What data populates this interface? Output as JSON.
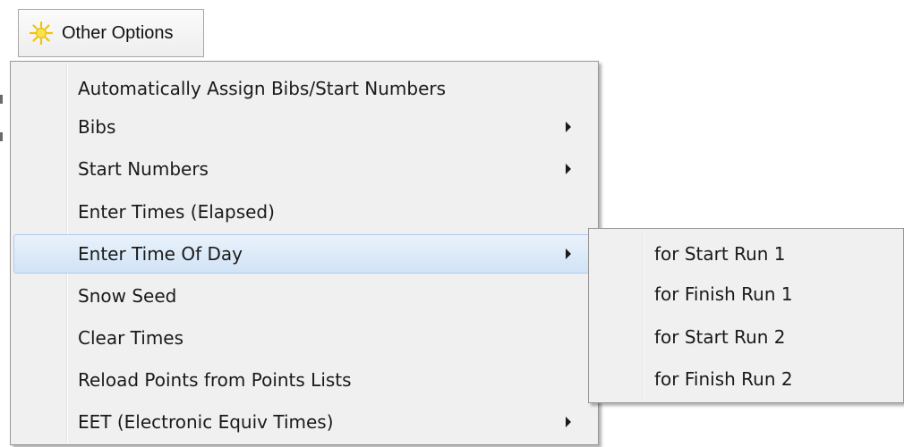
{
  "toolbar": {
    "label": "Other Options",
    "icon": "sun-icon"
  },
  "menu": {
    "items": [
      {
        "label": "Automatically Assign Bibs/Start Numbers",
        "submenu": false
      },
      {
        "label": "Bibs",
        "submenu": true
      },
      {
        "label": "Start Numbers",
        "submenu": true
      },
      {
        "label": "Enter Times (Elapsed)",
        "submenu": false
      },
      {
        "label": "Enter Time Of Day",
        "submenu": true,
        "highlighted": true
      },
      {
        "label": "Snow Seed",
        "submenu": false
      },
      {
        "label": "Clear Times",
        "submenu": false
      },
      {
        "label": "Reload Points from Points Lists",
        "submenu": false
      },
      {
        "label": "EET (Electronic Equiv Times)",
        "submenu": true
      }
    ]
  },
  "submenu": {
    "items": [
      {
        "label": "for Start Run 1"
      },
      {
        "label": "for Finish Run 1"
      },
      {
        "label": "for Start Run 2"
      },
      {
        "label": "for Finish Run 2"
      }
    ]
  },
  "colors": {
    "menu_background": "#f0f0f0",
    "highlight": "#d1e3f6",
    "border": "#979797",
    "icon_yellow": "#f7d21c"
  }
}
